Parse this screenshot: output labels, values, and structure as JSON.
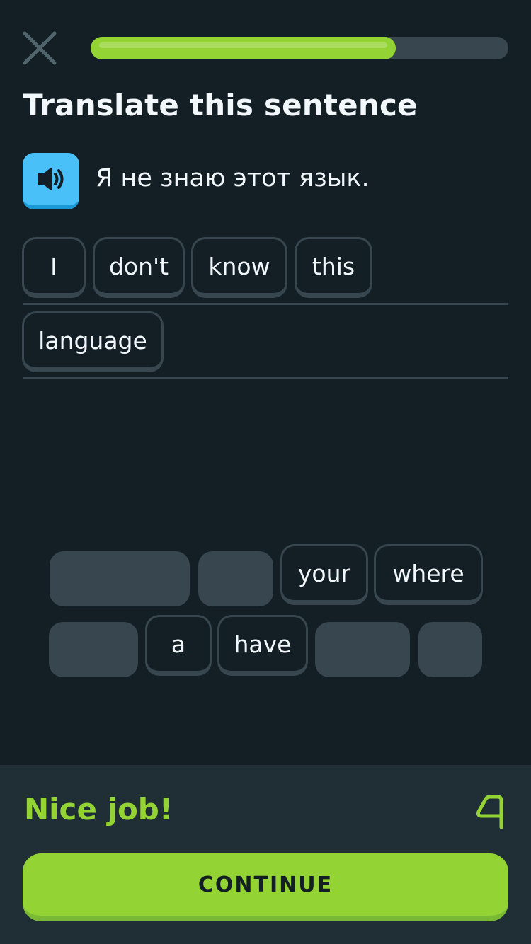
{
  "header": {
    "progress_percent": 73,
    "close_icon": "close-icon"
  },
  "title": "Translate this sentence",
  "prompt": {
    "speaker_icon": "speaker-icon",
    "text": "Я не знаю этот язык."
  },
  "answer_tiles": [
    {
      "label": "I"
    },
    {
      "label": "don't"
    },
    {
      "label": "know"
    },
    {
      "label": "this"
    },
    {
      "label": "language"
    }
  ],
  "word_bank": {
    "row1": [
      {
        "label": "",
        "used": true
      },
      {
        "label": "",
        "used": true
      },
      {
        "label": "your",
        "used": false
      },
      {
        "label": "where",
        "used": false
      }
    ],
    "row2": [
      {
        "label": "",
        "used": true
      },
      {
        "label": "a",
        "used": false
      },
      {
        "label": "have",
        "used": false
      },
      {
        "label": "",
        "used": true
      },
      {
        "label": "",
        "used": true
      }
    ]
  },
  "feedback": {
    "title": "Nice job!",
    "flag_icon": "flag-icon",
    "continue_label": "CONTINUE"
  },
  "colors": {
    "background": "#131f24",
    "tile_border": "#37464f",
    "accent_green": "#93d333",
    "accent_blue": "#49c0f8",
    "feedback_bg": "#202f36"
  }
}
